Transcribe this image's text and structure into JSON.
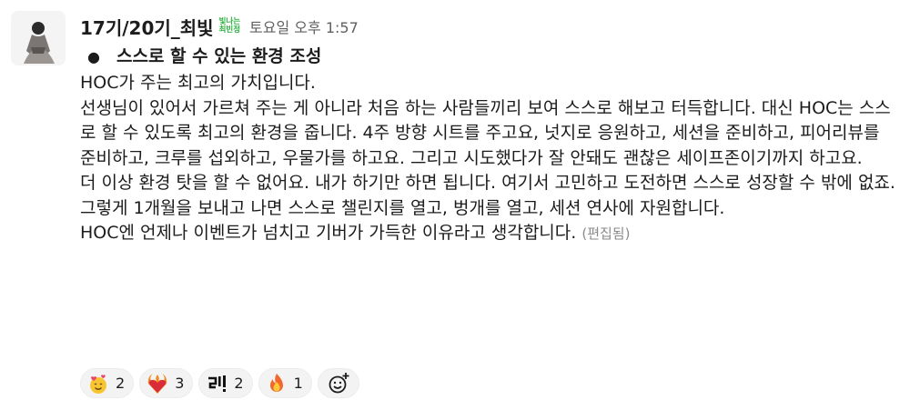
{
  "message": {
    "author": "17기/20기_최빛",
    "badge": {
      "line1": "빛나는",
      "line2": "최빈정"
    },
    "timestamp": "토요일 오후 1:57",
    "bullet": "스스로 할 수 있는 환경 조성",
    "paragraphs": [
      "HOC가 주는 최고의 가치입니다.",
      "선생님이 있어서 가르쳐 주는 게 아니라 처음 하는 사람들끼리 보여 스스로 해보고 터득합니다. 대신 HOC는 스스로 할 수 있도록 최고의 환경을 줍니다. 4주 방향 시트를 주고요, 넛지로 응원하고, 세션을 준비하고, 피어리뷰를 준비하고, 크루를 섭외하고, 우물가를 하고요. 그리고 시도했다가 잘 안돼도 괜찮은 세이프존이기까지 하고요.",
      "더 이상 환경 탓을 할 수 없어요. 내가 하기만 하면 됩니다. 여기서 고민하고 도전하면 스스로 성장할 수 밖에 없죠.",
      "그렇게 1개월을 보내고 나면 스스로 챌린지를 열고, 벙개를 열고, 세션 연사에 자원합니다."
    ],
    "last_paragraph": "HOC엔 언제나 이벤트가 넘치고 기버가 가득한 이유라고 생각합니다.",
    "edited_label": "(편집됨)"
  },
  "reactions": [
    {
      "icon": "smiling-face-with-hearts-icon",
      "count": "2"
    },
    {
      "icon": "heart-on-fire-icon",
      "count": "3"
    },
    {
      "icon": "custom-ri-exclamation-icon",
      "count": "2"
    },
    {
      "icon": "fire-icon",
      "count": "1"
    }
  ],
  "colors": {
    "badge_green": "#2bb13f",
    "reaction_bg": "#f3f3f3",
    "timestamp": "#616061"
  }
}
